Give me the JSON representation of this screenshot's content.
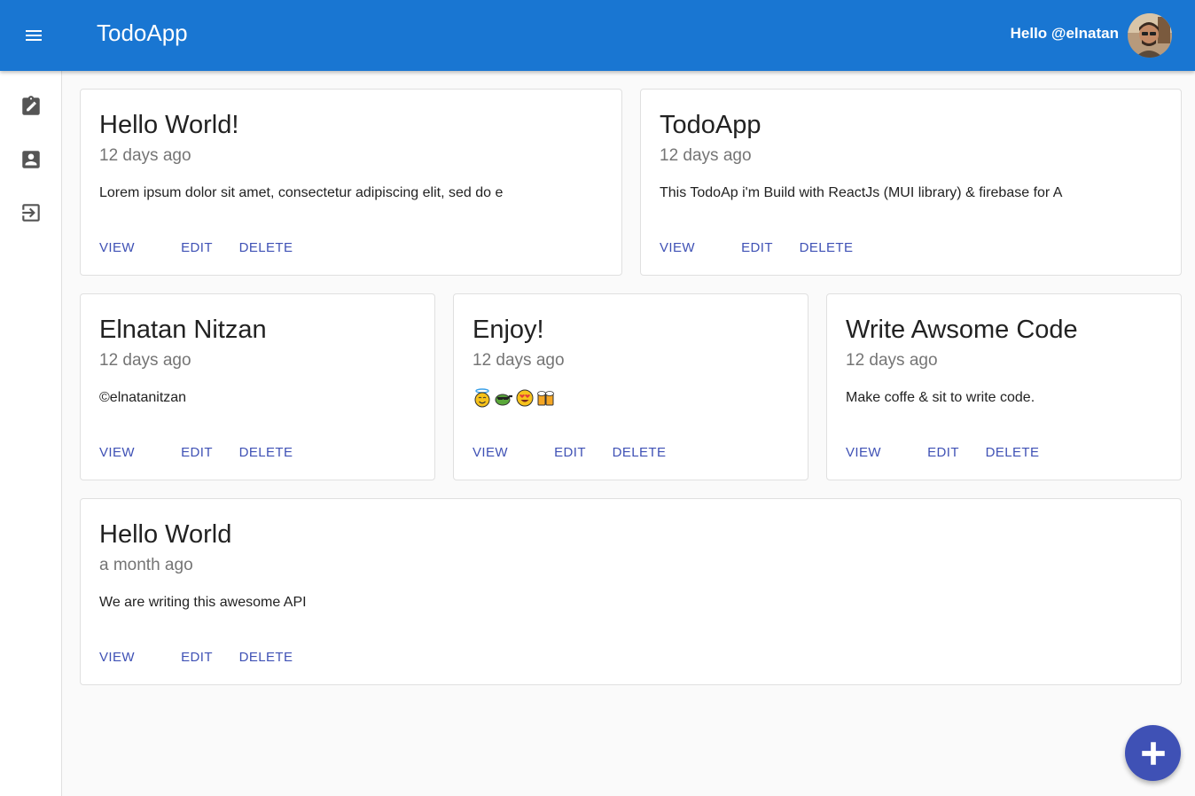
{
  "appbar": {
    "title": "TodoApp",
    "greeting": "Hello @elnatan",
    "icons": {
      "menu": "menu-icon",
      "avatar": "user-avatar"
    },
    "color": "#1976d2"
  },
  "sidebar": {
    "items": [
      {
        "icon": "assignment-edit-icon"
      },
      {
        "icon": "account-box-icon"
      },
      {
        "icon": "logout-icon"
      }
    ]
  },
  "todos": [
    {
      "title": "Hello World!",
      "date": "12 days ago",
      "body": "Lorem ipsum dolor sit amet, consectetur adipiscing elit, sed do e",
      "actions": {
        "view": "VIEW",
        "edit": "EDIT",
        "delete": "DELETE"
      }
    },
    {
      "title": "TodoApp",
      "date": "12 days ago",
      "body": "This TodoAp i'm Build with ReactJs (MUI library) & firebase for A",
      "actions": {
        "view": "VIEW",
        "edit": "EDIT",
        "delete": "DELETE"
      }
    },
    {
      "title": "Elnatan Nitzan",
      "date": "12 days ago",
      "body": "©elnatanitzan",
      "actions": {
        "view": "VIEW",
        "edit": "EDIT",
        "delete": "DELETE"
      }
    },
    {
      "title": "Enjoy!",
      "date": "12 days ago",
      "emojis": [
        "smiling-face-with-halo",
        "turtle-sunglasses",
        "heart-eyes-face",
        "beer-mugs"
      ],
      "actions": {
        "view": "VIEW",
        "edit": "EDIT",
        "delete": "DELETE"
      }
    },
    {
      "title": "Write Awsome Code",
      "date": "12 days ago",
      "body": "Make coffe & sit to write code.",
      "actions": {
        "view": "VIEW",
        "edit": "EDIT",
        "delete": "DELETE"
      }
    },
    {
      "title": "Hello World",
      "date": "a month ago",
      "body": "We are writing this awesome API",
      "actions": {
        "view": "VIEW",
        "edit": "EDIT",
        "delete": "DELETE"
      }
    }
  ],
  "fab": {
    "icon": "add-icon",
    "color": "#3f51b5"
  },
  "colors": {
    "accent": "#3f51b5",
    "muted": "#757575"
  }
}
